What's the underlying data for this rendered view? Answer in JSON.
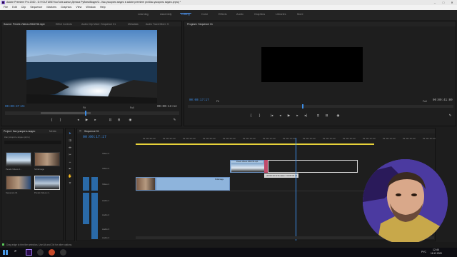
{
  "window": {
    "title": "Adobe Premiere Pro 2020 - D:\\YOUTUBE\\YouTube-канал Дениса Рубина\\Видео\\3 - Как ускорить видео в adobe premiere pro\\Как ускорить видео.prproj *"
  },
  "menu": [
    "File",
    "Edit",
    "Clip",
    "Sequence",
    "Markers",
    "Graphics",
    "View",
    "Window",
    "Help"
  ],
  "workspaces": {
    "items": [
      "Learning",
      "Assembly",
      "Editing",
      "Color",
      "Effects",
      "Audio",
      "Graphics",
      "Libraries",
      "More"
    ],
    "active": "Editing"
  },
  "source_panel": {
    "tabs": [
      "Source: Pexels Videos 2064736.mp4",
      "Effect Controls",
      "Audio Clip Mixer: Sequence 01",
      "Metadata",
      "Audio Track Mixer: S"
    ],
    "timecode": "00:00:37:24",
    "fit": "Fit",
    "quality": "Full",
    "duration": "00:00:13:14"
  },
  "program_panel": {
    "tab": "Program: Sequence 01",
    "timecode": "00:00:17:17",
    "fit": "Fit",
    "quality": "Full",
    "duration": "00:00:41:00"
  },
  "project_panel": {
    "tabs": [
      "Project: Как ускорить видео",
      "Media"
    ],
    "path": "Как ускорить видео.prproj",
    "items": [
      {
        "name": "Pexels Videos 2...",
        "duration": ""
      },
      {
        "name": "Siritalmage",
        "duration": ""
      },
      {
        "name": "Sequence 01",
        "duration": ""
      },
      {
        "name": "Pexels Videos 2...",
        "duration": ""
      }
    ]
  },
  "timeline": {
    "tab": "Sequence 01",
    "timecode": "00:00:17:17",
    "ruler": [
      "00:00:00:00",
      "00:00:02:00",
      "00:00:04:00",
      "00:00:06:00",
      "00:00:08:00",
      "00:00:10:00",
      "00:00:12:00",
      "00:00:14:00",
      "00:00:16:00",
      "00:00:18:00",
      "00:00:20:00",
      "00:00:22:00",
      "00:00:24:00",
      "00:00:26:00",
      "00:00:28:00"
    ],
    "tracks_video": [
      "V3",
      "V2",
      "V1"
    ],
    "tracks_audio": [
      "A1",
      "A2",
      "A3",
      "A4"
    ],
    "track_names": [
      "Video 3",
      "Video 2",
      "Video 1",
      "Audio 1",
      "Audio 2",
      "Audio 3",
      "Audio 4"
    ],
    "clip_v2_label": "Pexels Videos 2064736.mp4",
    "clip_v1_label": "SiritaImage",
    "tooltip": "+00:00:10:13 Duration: 00:00:15:24"
  },
  "status": {
    "text": "Drag edge to trim the selection. Use Alt and Ctrl for other options."
  },
  "taskbar": {
    "lang": "РУС",
    "time": "12:46",
    "date": "16.12.2020"
  },
  "colors": {
    "accent": "#4a8fe8",
    "timecode": "#3d8ee8",
    "clip_blue": "#8eb4dc",
    "work_area": "#e7d23a"
  },
  "icons": [
    "premiere-icon",
    "search-icon",
    "play-icon",
    "step-back-icon",
    "step-forward-icon",
    "mark-in-icon",
    "mark-out-icon",
    "wrench-icon",
    "selection-tool-icon",
    "razor-tool-icon",
    "hand-tool-icon",
    "type-tool-icon",
    "windows-start-icon"
  ]
}
